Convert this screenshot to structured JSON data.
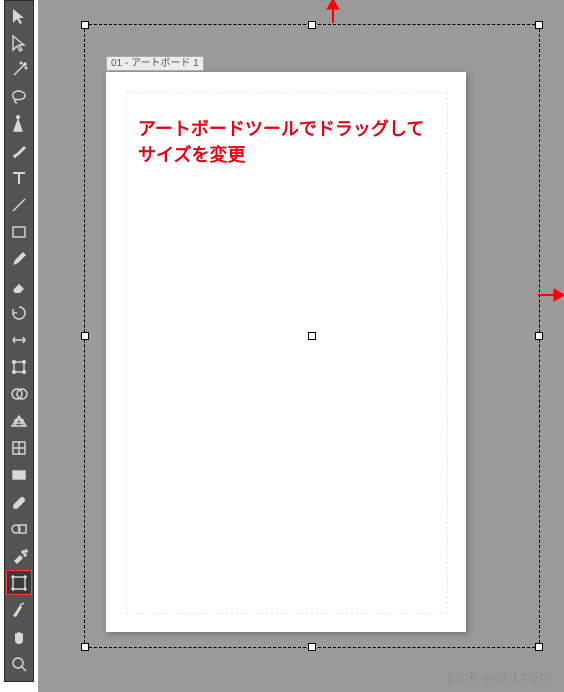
{
  "toolbar": {
    "tools": [
      {
        "id": "selection-tool"
      },
      {
        "id": "direct-selection-tool"
      },
      {
        "id": "magic-wand-tool"
      },
      {
        "id": "lasso-tool"
      },
      {
        "id": "pen-tool"
      },
      {
        "id": "paintbrush-tool"
      },
      {
        "id": "type-tool"
      },
      {
        "id": "line-tool"
      },
      {
        "id": "rectangle-tool"
      },
      {
        "id": "pencil-tool"
      },
      {
        "id": "eraser-tool"
      },
      {
        "id": "rotate-tool"
      },
      {
        "id": "width-tool"
      },
      {
        "id": "free-transform-tool"
      },
      {
        "id": "shape-builder-tool"
      },
      {
        "id": "perspective-grid-tool"
      },
      {
        "id": "mesh-tool"
      },
      {
        "id": "gradient-tool"
      },
      {
        "id": "eyedropper-tool"
      },
      {
        "id": "blend-tool"
      },
      {
        "id": "symbol-sprayer-tool"
      },
      {
        "id": "artboard-tool",
        "selected": true
      },
      {
        "id": "slice-tool"
      },
      {
        "id": "hand-tool"
      },
      {
        "id": "zoom-tool"
      }
    ]
  },
  "artboard": {
    "label": "01 - アートボード 1"
  },
  "annotation": {
    "text": "アートボードツールでドラッグしてサイズを変更"
  },
  "watermark": "junk-word.com"
}
